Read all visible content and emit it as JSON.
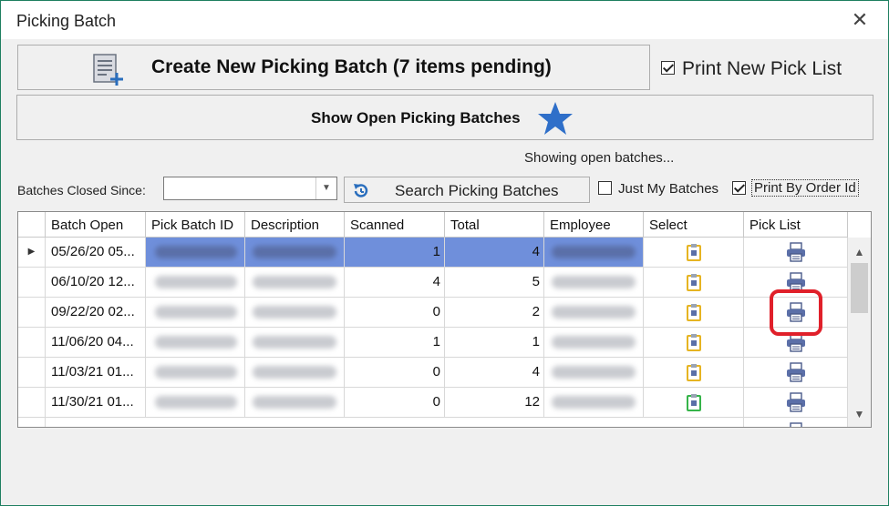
{
  "window": {
    "title": "Picking Batch",
    "close_glyph": "✕"
  },
  "create_button": {
    "label": "Create New Picking Batch (7 items pending)",
    "icon": "add-document-icon"
  },
  "print_new_pick_list": {
    "label": "Print New Pick List",
    "checked": true
  },
  "open_batches_button": {
    "label": "Show Open Picking Batches",
    "icon": "star-icon"
  },
  "status_text": "Showing open batches...",
  "filters": {
    "closed_since_label": "Batches Closed Since:",
    "closed_since_value": "",
    "search_button_label": "Search Picking Batches",
    "just_my_batches_label": "Just My Batches",
    "just_my_batches_checked": false,
    "print_by_order_label": "Print By Order Id",
    "print_by_order_checked": true
  },
  "grid": {
    "columns": [
      "Batch Open",
      "Pick Batch ID",
      "Description",
      "Scanned",
      "Total",
      "Employee",
      "Select",
      "Pick List"
    ],
    "rows": [
      {
        "batch_open": "05/26/20 05...",
        "scanned": "1",
        "total": "4",
        "selected": true
      },
      {
        "batch_open": "06/10/20 12...",
        "scanned": "4",
        "total": "5"
      },
      {
        "batch_open": "09/22/20 02...",
        "scanned": "0",
        "total": "2"
      },
      {
        "batch_open": "11/06/20 04...",
        "scanned": "1",
        "total": "1"
      },
      {
        "batch_open": "11/03/21 01...",
        "scanned": "0",
        "total": "4"
      },
      {
        "batch_open": "11/30/21 01...",
        "scanned": "0",
        "total": "12"
      }
    ]
  },
  "colors": {
    "selection": "#6f8fdb",
    "highlight": "#e0202a",
    "accent_star": "#2f6fc9"
  }
}
